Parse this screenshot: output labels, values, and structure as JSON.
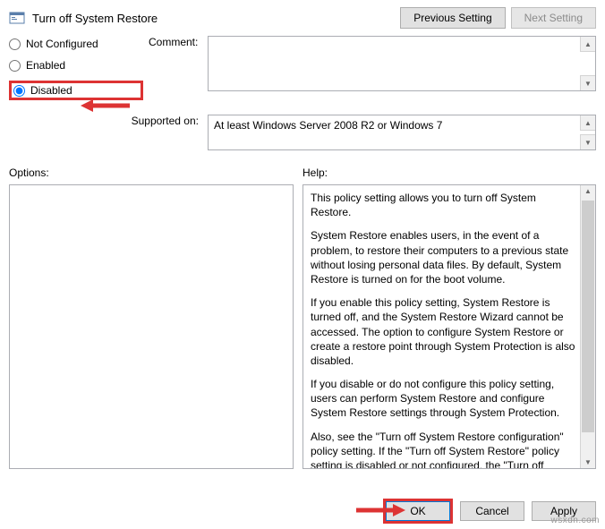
{
  "title": "Turn off System Restore",
  "nav": {
    "prev": "Previous Setting",
    "next": "Next Setting"
  },
  "radios": {
    "not_configured": "Not Configured",
    "enabled": "Enabled",
    "disabled": "Disabled"
  },
  "labels": {
    "comment": "Comment:",
    "supported": "Supported on:",
    "options": "Options:",
    "help": "Help:"
  },
  "supported_text": "At least Windows Server 2008 R2 or Windows 7",
  "help": {
    "p1": "This policy setting allows you to turn off System Restore.",
    "p2": "System Restore enables users, in the event of a problem, to restore their computers to a previous state without losing personal data files. By default, System Restore is turned on for the boot volume.",
    "p3": "If you enable this policy setting, System Restore is turned off, and the System Restore Wizard cannot be accessed. The option to configure System Restore or create a restore point through System Protection is also disabled.",
    "p4": "If you disable or do not configure this policy setting, users can perform System Restore and configure System Restore settings through System Protection.",
    "p5": "Also, see the \"Turn off System Restore configuration\" policy setting. If the \"Turn off System Restore\" policy setting is disabled or not configured, the \"Turn off System Restore configuration\" policy setting is used to determine whether the option to configure System Restore is available."
  },
  "footer": {
    "ok": "OK",
    "cancel": "Cancel",
    "apply": "Apply"
  },
  "watermark": "wsxdn.com"
}
